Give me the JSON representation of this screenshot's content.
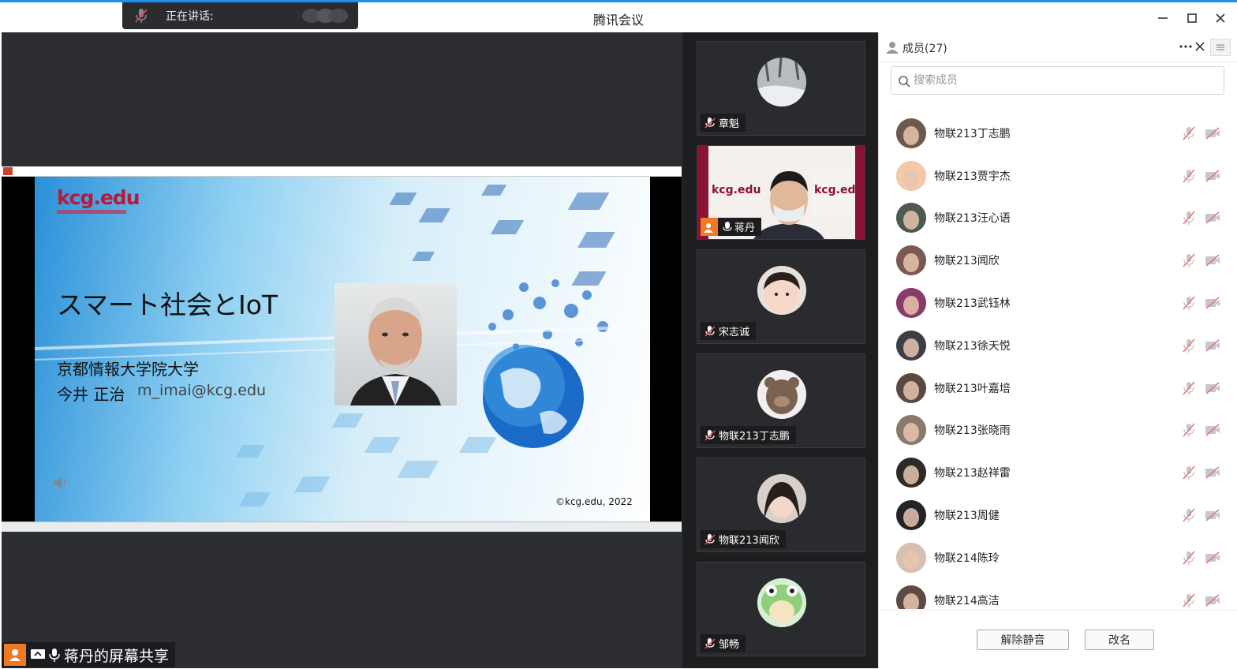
{
  "window": {
    "title": "腾讯会议"
  },
  "speaking": {
    "label": "正在讲话:"
  },
  "slide": {
    "logo": "kcg.edu",
    "title": "スマート社会とIoT",
    "university": "京都情報大学院大学",
    "presenter": "今井 正治",
    "email": "m_imai@kcg.edu",
    "copyright": "©kcg.edu, 2022"
  },
  "share": {
    "label": "蒋丹的屏幕共享"
  },
  "gallery": {
    "tiles": [
      {
        "name": "章魁"
      },
      {
        "name": "蒋丹"
      },
      {
        "name": "宋志诚"
      },
      {
        "name": "物联213丁志鹏"
      },
      {
        "name": "物联213闻欣"
      },
      {
        "name": "邹畅"
      }
    ]
  },
  "panel": {
    "header": "成员(27)",
    "search_placeholder": "搜索成员",
    "members": [
      {
        "name": "物联213丁志鹏",
        "color": "#6b5a4c"
      },
      {
        "name": "物联213贾宇杰",
        "color": "#f4c9a8"
      },
      {
        "name": "物联213汪心语",
        "color": "#4d5a50"
      },
      {
        "name": "物联213闻欣",
        "color": "#7a5a50"
      },
      {
        "name": "物联213武钰林",
        "color": "#8a3b6a"
      },
      {
        "name": "物联213徐天悦",
        "color": "#3a3f48"
      },
      {
        "name": "物联213叶嘉培",
        "color": "#5a4a40"
      },
      {
        "name": "物联213张晓雨",
        "color": "#8a7a6a"
      },
      {
        "name": "物联213赵祥雷",
        "color": "#2e2a28"
      },
      {
        "name": "物联213周健",
        "color": "#222426"
      },
      {
        "name": "物联214陈玲",
        "color": "#d8bfb0"
      },
      {
        "name": "物联214高洁",
        "color": "#5b4b44"
      }
    ],
    "unmute_button": "解除静音",
    "rename_button": "改名"
  }
}
